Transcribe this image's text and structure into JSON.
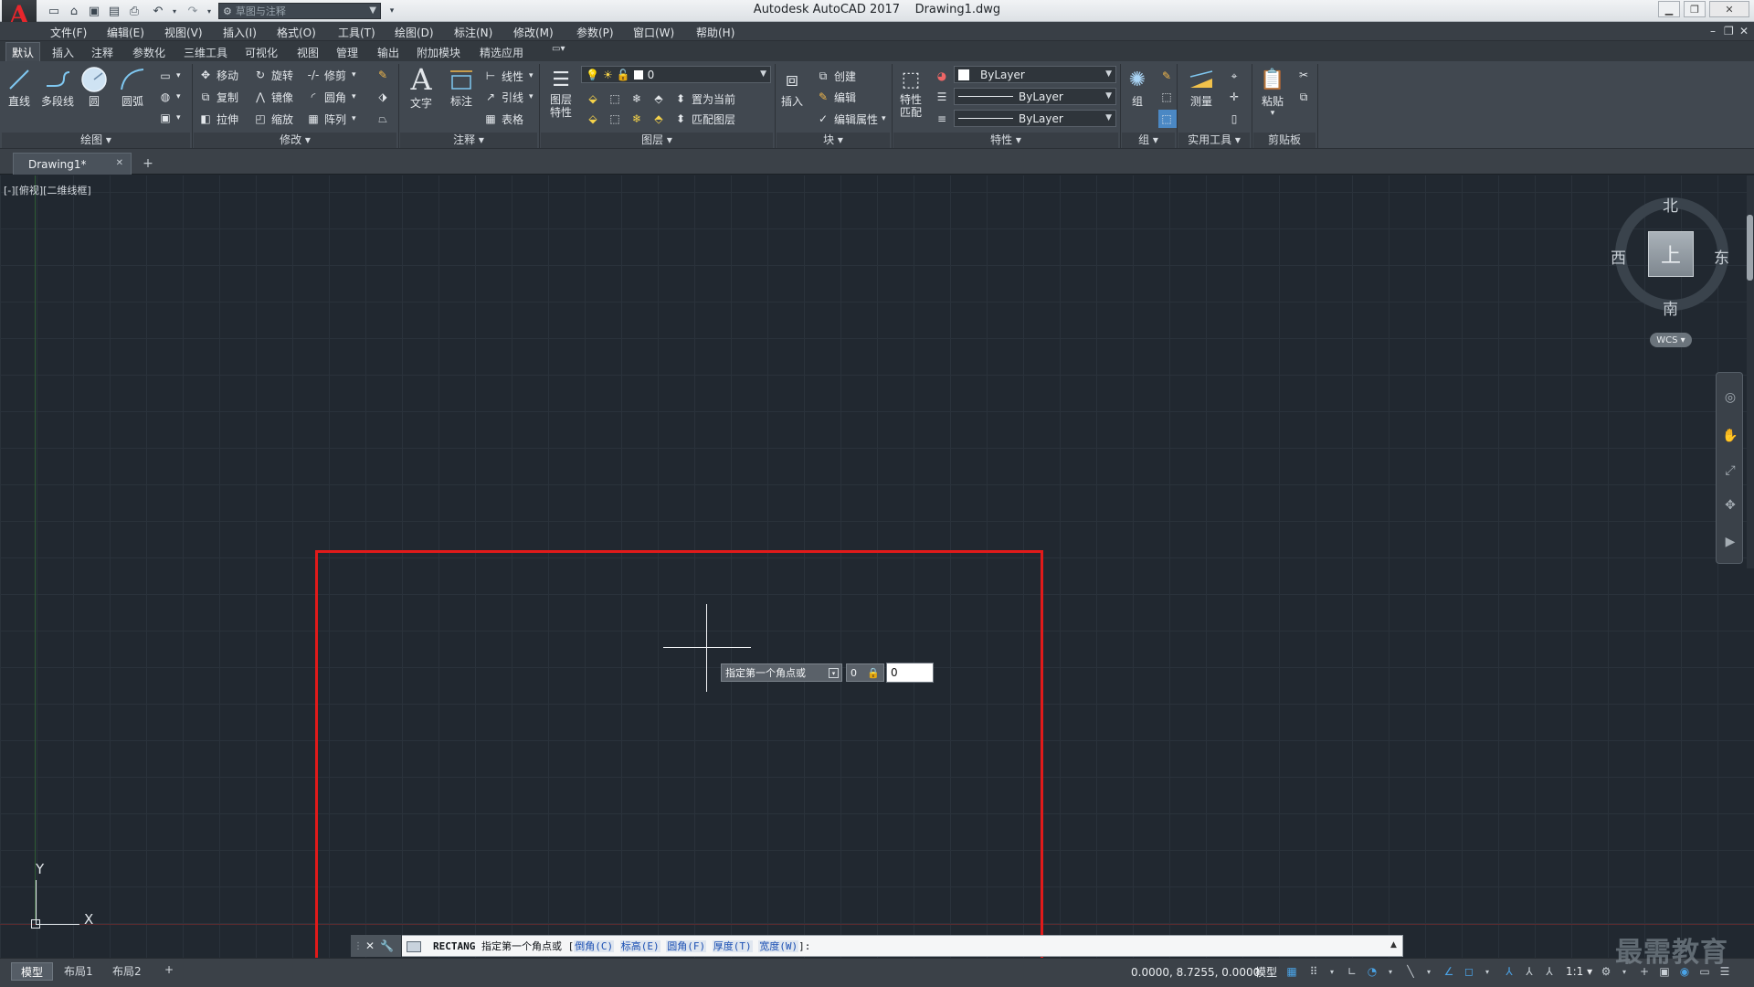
{
  "title_bar": {
    "app_title": "Autodesk AutoCAD 2017",
    "file_name": "Drawing1.dwg",
    "workspace": "草图与注释"
  },
  "menu": [
    "文件(F)",
    "编辑(E)",
    "视图(V)",
    "插入(I)",
    "格式(O)",
    "工具(T)",
    "绘图(D)",
    "标注(N)",
    "修改(M)",
    "参数(P)",
    "窗口(W)",
    "帮助(H)"
  ],
  "ribbon_tabs": [
    "默认",
    "插入",
    "注释",
    "参数化",
    "三维工具",
    "可视化",
    "视图",
    "管理",
    "输出",
    "附加模块",
    "精选应用"
  ],
  "ribbon": {
    "draw": {
      "title": "绘图",
      "line": "直线",
      "polyline": "多段线",
      "circle": "圆",
      "arc": "圆弧"
    },
    "modify": {
      "title": "修改",
      "move": "移动",
      "rotate": "旋转",
      "trim": "修剪",
      "copy": "复制",
      "mirror": "镜像",
      "fillet": "圆角",
      "stretch": "拉伸",
      "scale": "缩放",
      "array": "阵列"
    },
    "annotation": {
      "title": "注释",
      "text": "文字",
      "dimension": "标注",
      "linear": "线性",
      "leader": "引线",
      "table": "表格"
    },
    "layers": {
      "title": "图层",
      "layer_props": "图层特性",
      "current_layer": "0",
      "set_current": "置为当前",
      "match_layer": "匹配图层"
    },
    "block": {
      "title": "块",
      "insert": "插入",
      "create": "创建",
      "edit": "编辑",
      "edit_attr": "编辑属性"
    },
    "properties": {
      "title": "特性",
      "match": "特性匹配",
      "color": "ByLayer",
      "linetype": "ByLayer",
      "lineweight": "ByLayer"
    },
    "groups": {
      "title": "组",
      "group": "组"
    },
    "utilities": {
      "title": "实用工具",
      "measure": "测量"
    },
    "clipboard": {
      "title": "剪贴板",
      "paste": "粘贴"
    }
  },
  "doc_tab": "Drawing1*",
  "viewport_label": "[-][俯视][二维线框]",
  "viewcube": {
    "north": "北",
    "south": "南",
    "east": "东",
    "west": "西",
    "face": "上",
    "wcs": "WCS"
  },
  "ucs": {
    "x": "X",
    "y": "Y"
  },
  "dynamic_input": {
    "prompt": "指定第一个角点或",
    "x_value": "0",
    "y_value": "0"
  },
  "command_line": {
    "command": "RECTANG",
    "prompt": "指定第一个角点或",
    "options": [
      "倒角(C)",
      "标高(E)",
      "圆角(F)",
      "厚度(T)",
      "宽度(W)"
    ],
    "suffix": "]:"
  },
  "layout_tabs": [
    "模型",
    "布局1",
    "布局2"
  ],
  "status": {
    "coords": "0.0000, 8.7255, 0.0000",
    "model": "模型",
    "scale": "1:1"
  },
  "watermark": "最需教育"
}
